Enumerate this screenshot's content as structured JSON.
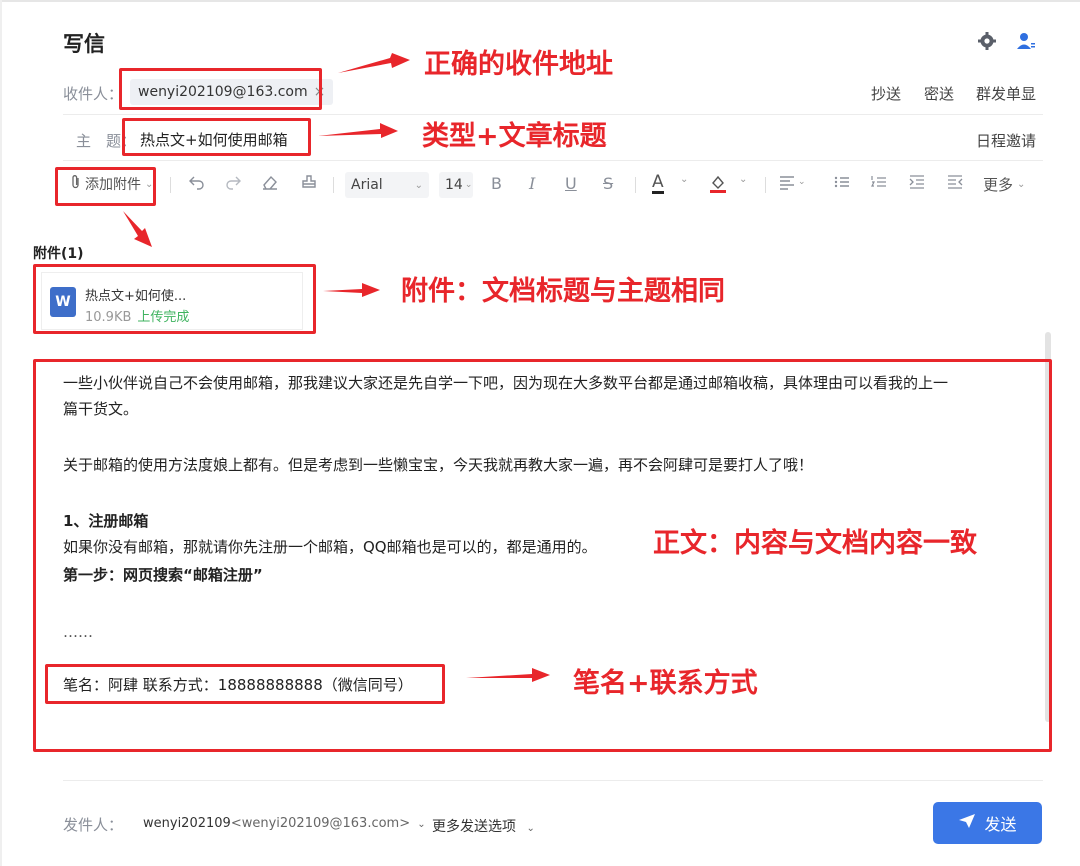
{
  "compose": {
    "title": "写信",
    "to_label": "收件人：",
    "recipient": "wenyi202109@163.com",
    "recipient_close": "×",
    "cc": "抄送",
    "bcc": "密送",
    "mass_send": "群发单显",
    "subject_label": "主　题：",
    "subject": "热点文+如何使用邮箱",
    "schedule_invite": "日程邀请"
  },
  "toolbar": {
    "add_attachment": "添加附件",
    "font": "Arial",
    "size": "14",
    "bold": "B",
    "italic": "I",
    "underline": "U",
    "strike": "S",
    "font_color": "A",
    "more": "更多"
  },
  "attachments": {
    "title": "附件(1)",
    "items": [
      {
        "icon": "W",
        "name": "热点文+如何使...",
        "size": "10.9KB",
        "status": "上传完成"
      }
    ]
  },
  "body": {
    "line1": "一些小伙伴说自己不会使用邮箱，那我建议大家还是先自学一下吧，因为现在大多数平台都是通过邮箱收稿，具体理由可以看我的上一",
    "line2": "篇干货文。",
    "line3": "关于邮箱的使用方法度娘上都有。但是考虑到一些懒宝宝，今天我就再教大家一遍，再不会阿肆可是要打人了哦！",
    "heading1": "1、注册邮箱",
    "line4": "如果你没有邮箱，那就请你先注册一个邮箱，QQ邮箱也是可以的，都是通用的。",
    "step1": "第一步：网页搜索“邮箱注册”",
    "ellipsis": "……",
    "signature": "笔名：阿肆 联系方式：18888888888（微信同号）"
  },
  "footer": {
    "sender_label": "发件人：",
    "sender": "wenyi202109",
    "sender_email": "<wenyi202109@163.com>",
    "more_options": "更多发送选项",
    "send": "发送"
  },
  "annotations": {
    "recipient_note": "正确的收件地址",
    "subject_note": "类型+文章标题",
    "attachment_note": "附件：文档标题与主题相同",
    "body_note": "正文：内容与文档内容一致",
    "signature_note": "笔名+联系方式"
  },
  "colors": {
    "annotation_red": "#e8262b",
    "send_blue": "#3b77e6",
    "upload_green": "#3fb35f"
  }
}
